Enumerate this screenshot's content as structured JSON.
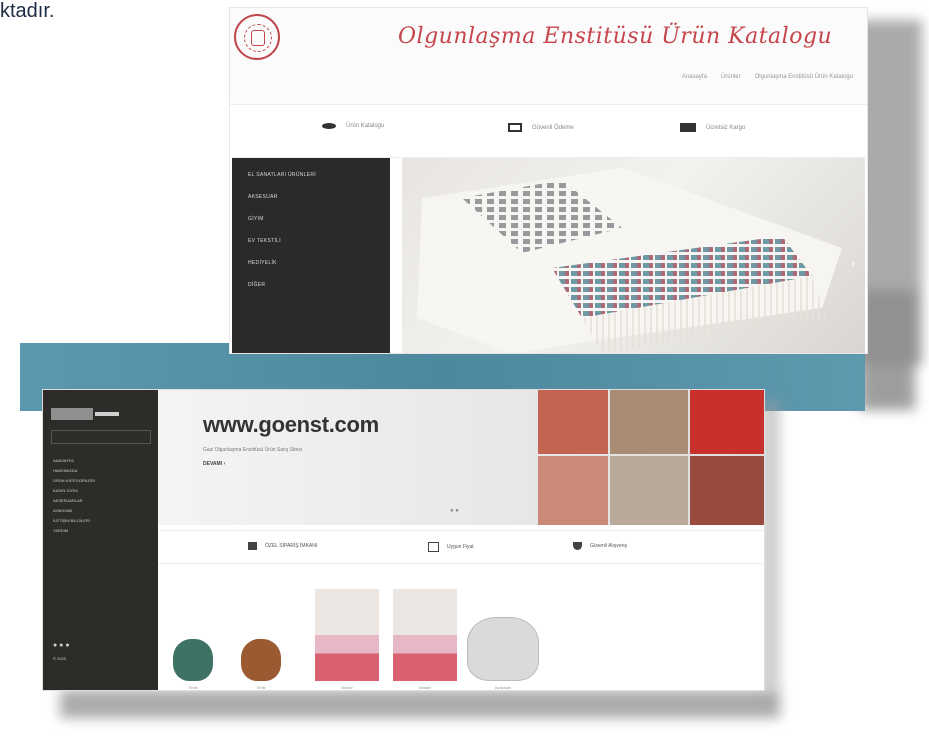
{
  "page": {
    "top_text": "ktadır."
  },
  "site1": {
    "title": "Olgunlaşma Enstitüsü Ürün Katalogu",
    "top_links": [
      "Anasayfa",
      "Ürünler",
      "Olgunlaşma Enstitüsü Ürün Katalogu"
    ],
    "features": [
      {
        "icon": "eye-icon",
        "label": "Ürün Katalogu"
      },
      {
        "icon": "card-icon",
        "label": "Güvenli Ödeme"
      },
      {
        "icon": "truck-icon",
        "label": "Ücretsiz Kargo"
      }
    ],
    "menu": [
      "EL SANATLARI ÜRÜNLERİ",
      "AKSESUAR",
      "GİYİM",
      "EV TEKSTİLİ",
      "HEDİYELİK",
      "DİĞER"
    ],
    "hero_arrow": "›"
  },
  "site2": {
    "url": "www.goenst.com",
    "tagline": "Gazi Olgunlaşma Enstitüsü Ürün Satış Sitesi",
    "more": "DEVAMI ›",
    "slider_dots": "● ●",
    "sidebar_items": [
      "ANASAYFA",
      "HAKKIMIZDA",
      "ÜRÜN KATEGORİLERİ",
      "KADIN GİYİM",
      "AKSESUARLAR",
      "AYAKKABI",
      "İLETİŞİM BİLGİLERİ",
      "YARDIM"
    ],
    "sidebar_footer": "© 2020",
    "features": [
      {
        "icon": "gift-icon",
        "label": "ÖZEL SİPARİŞ İMKANI"
      },
      {
        "icon": "tag-icon",
        "label": "Uygun Fiyat"
      },
      {
        "icon": "shield-icon",
        "label": "Güvenli Alışveriş"
      }
    ],
    "products": [
      {
        "name": "Terlik",
        "color": "#3e7264"
      },
      {
        "name": "Terlik",
        "color": "#9b5a32"
      },
      {
        "name": "Maske",
        "color": "#e7b7c5"
      },
      {
        "name": "Maske",
        "color": "#e7b7c5"
      },
      {
        "name": "Ayakkabı",
        "color": "#d9dbd8"
      }
    ]
  }
}
